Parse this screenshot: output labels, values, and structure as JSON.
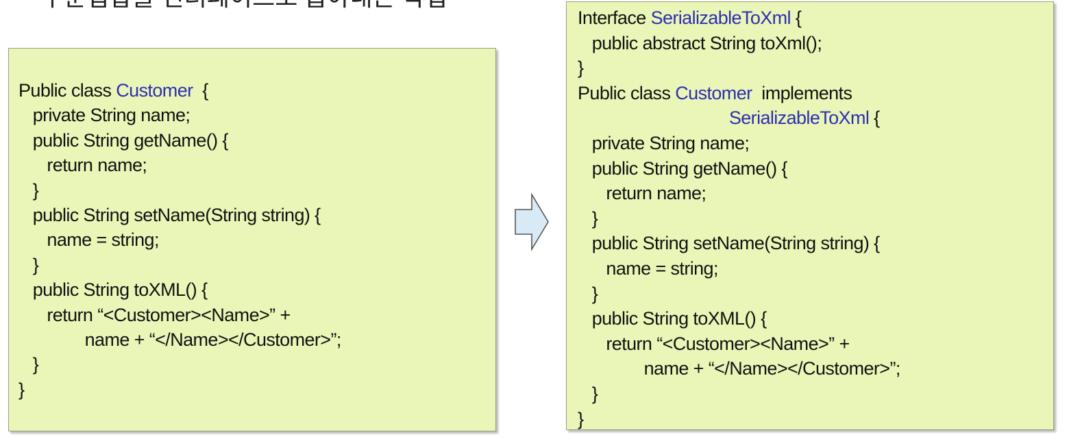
{
  "title": "부분집합을 인터페이스로 뽑아내는 작업",
  "colors": {
    "box_fill": "#eaf6b8",
    "box_border": "#9aa07a",
    "type_name": "#2d2fb0",
    "text": "#111111",
    "arrow_fill": "#d9eaf7",
    "arrow_stroke": "#555555"
  },
  "left_code": [
    [
      {
        "t": "Public class "
      },
      {
        "t": "Customer",
        "k": 1
      },
      {
        "t": "  {"
      }
    ],
    [
      {
        "t": "   private String name;"
      }
    ],
    [
      {
        "t": "   public String getName() {"
      }
    ],
    [
      {
        "t": "      return name;"
      }
    ],
    [
      {
        "t": "   }"
      }
    ],
    [
      {
        "t": "   public String setName(String string) {"
      }
    ],
    [
      {
        "t": "      name = string;"
      }
    ],
    [
      {
        "t": "   }"
      }
    ],
    [
      {
        "t": "   public String toXML() {"
      }
    ],
    [
      {
        "t": "      return “<Customer><Name>” +"
      }
    ],
    [
      {
        "t": "              name + “</Name></Customer>”;"
      }
    ],
    [
      {
        "t": "   }"
      }
    ],
    [
      {
        "t": "}"
      }
    ]
  ],
  "right_code": [
    [
      {
        "t": "Interface "
      },
      {
        "t": "SerializableToXml",
        "k": 1
      },
      {
        "t": " {"
      }
    ],
    [
      {
        "t": "   public abstract String toXml();"
      }
    ],
    [
      {
        "t": "}"
      }
    ],
    [
      {
        "t": "Public class "
      },
      {
        "t": "Customer",
        "k": 1
      },
      {
        "t": "  implements"
      }
    ],
    [
      {
        "t": "                                "
      },
      {
        "t": "SerializableToXml",
        "k": 1
      },
      {
        "t": " {"
      }
    ],
    [
      {
        "t": "   private String name;"
      }
    ],
    [
      {
        "t": "   public String getName() {"
      }
    ],
    [
      {
        "t": "      return name;"
      }
    ],
    [
      {
        "t": "   }"
      }
    ],
    [
      {
        "t": "   public String setName(String string) {"
      }
    ],
    [
      {
        "t": "      name = string;"
      }
    ],
    [
      {
        "t": "   }"
      }
    ],
    [
      {
        "t": "   public String toXML() {"
      }
    ],
    [
      {
        "t": "      return “<Customer><Name>” +"
      }
    ],
    [
      {
        "t": "              name + “</Name></Customer>”;"
      }
    ],
    [
      {
        "t": "   }"
      }
    ],
    [
      {
        "t": "}"
      }
    ]
  ],
  "arrow_icon": "right-arrow-icon"
}
